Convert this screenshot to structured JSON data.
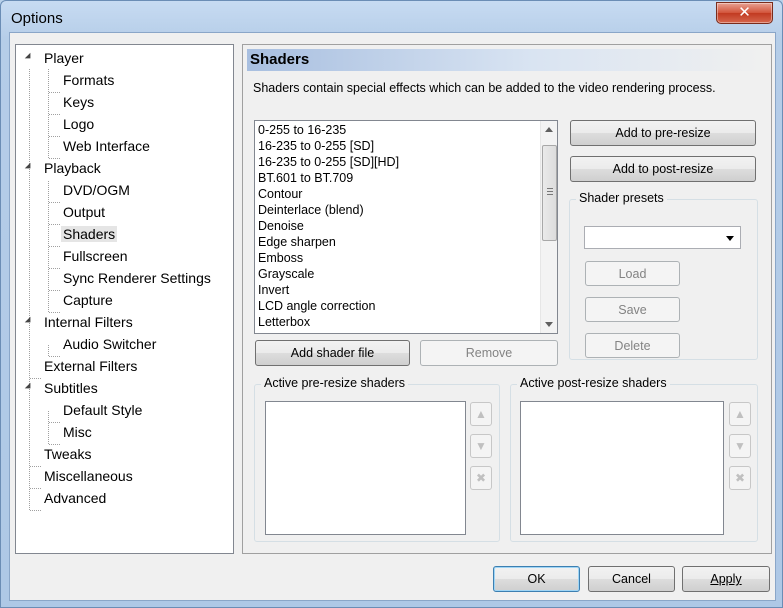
{
  "window": {
    "title": "Options"
  },
  "tree": [
    {
      "label": "Player",
      "expanded": true
    },
    {
      "label": "Formats"
    },
    {
      "label": "Keys"
    },
    {
      "label": "Logo"
    },
    {
      "label": "Web Interface"
    },
    {
      "label": "Playback",
      "expanded": true
    },
    {
      "label": "DVD/OGM"
    },
    {
      "label": "Output"
    },
    {
      "label": "Shaders",
      "selected": true
    },
    {
      "label": "Fullscreen"
    },
    {
      "label": "Sync Renderer Settings"
    },
    {
      "label": "Capture"
    },
    {
      "label": "Internal Filters",
      "expanded": true
    },
    {
      "label": "Audio Switcher"
    },
    {
      "label": "External Filters"
    },
    {
      "label": "Subtitles",
      "expanded": true
    },
    {
      "label": "Default Style"
    },
    {
      "label": "Misc"
    },
    {
      "label": "Tweaks"
    },
    {
      "label": "Miscellaneous"
    },
    {
      "label": "Advanced"
    }
  ],
  "panel": {
    "header": "Shaders",
    "description": "Shaders contain special effects which can be added to the video rendering process.",
    "shaders": [
      "0-255 to 16-235",
      "16-235 to 0-255 [SD]",
      "16-235 to 0-255 [SD][HD]",
      "BT.601 to BT.709",
      "Contour",
      "Deinterlace (blend)",
      "Denoise",
      "Edge sharpen",
      "Emboss",
      "Grayscale",
      "Invert",
      "LCD angle correction",
      "Letterbox"
    ],
    "add_pre_resize": "Add to pre-resize",
    "add_post_resize": "Add to post-resize",
    "presets_title": "Shader presets",
    "preset_value": "",
    "load": "Load",
    "save": "Save",
    "delete": "Delete",
    "add_shader_file": "Add shader file",
    "remove": "Remove",
    "active_pre": "Active pre-resize shaders",
    "active_post": "Active post-resize shaders"
  },
  "footer": {
    "ok": "OK",
    "cancel": "Cancel",
    "apply": "Apply"
  },
  "icons": {
    "close": "close-icon",
    "up": "arrow-up-icon",
    "down": "arrow-down-icon",
    "remove": "remove-x-icon"
  }
}
